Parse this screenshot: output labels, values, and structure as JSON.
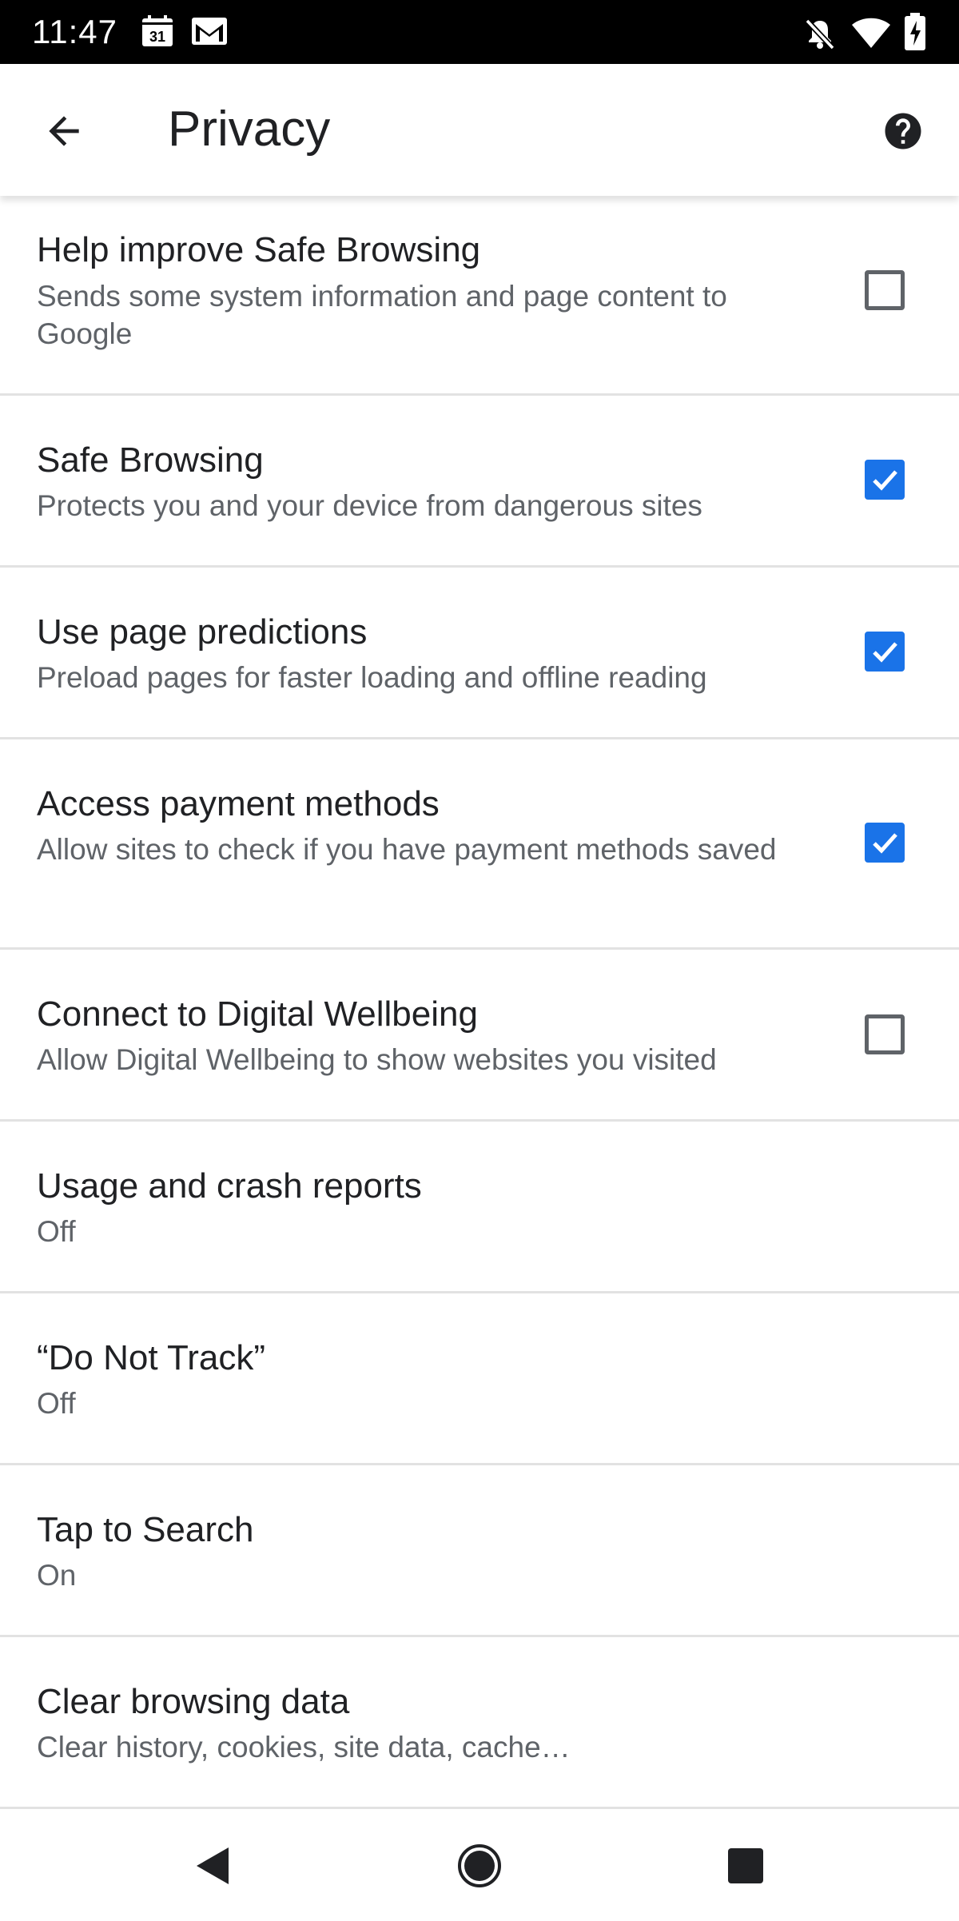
{
  "status_bar": {
    "time": "11:47",
    "calendar_day": "31",
    "left_icons": [
      "calendar-icon",
      "gmail-icon"
    ],
    "right_icons": [
      "notifications-off-icon",
      "wifi-icon",
      "battery-charging-icon"
    ]
  },
  "app_bar": {
    "title": "Privacy",
    "back_icon": "arrow-back-icon",
    "help_icon": "help-icon"
  },
  "colors": {
    "accent": "#1a73e8",
    "title_text": "#202124",
    "subtitle_text": "#5f6368",
    "divider": "#e2e2e2"
  },
  "settings": [
    {
      "title": "Help improve Safe Browsing",
      "subtitle": "Sends some system information and page content to Google",
      "control": "checkbox",
      "checked": false
    },
    {
      "title": "Safe Browsing",
      "subtitle": "Protects you and your device from dangerous sites",
      "control": "checkbox",
      "checked": true
    },
    {
      "title": "Use page predictions",
      "subtitle": "Preload pages for faster loading and offline reading",
      "control": "checkbox",
      "checked": true
    },
    {
      "title": "Access payment methods",
      "subtitle": "Allow sites to check if you have payment methods saved",
      "control": "checkbox",
      "checked": true
    },
    {
      "title": "Connect to Digital Wellbeing",
      "subtitle": "Allow Digital Wellbeing to show websites you visited",
      "control": "checkbox",
      "checked": false
    },
    {
      "title": "Usage and crash reports",
      "subtitle": "Off",
      "control": "none"
    },
    {
      "title": "“Do Not Track”",
      "subtitle": "Off",
      "control": "none"
    },
    {
      "title": "Tap to Search",
      "subtitle": "On",
      "control": "none"
    },
    {
      "title": "Clear browsing data",
      "subtitle": "Clear history, cookies, site data, cache…",
      "control": "none"
    }
  ],
  "nav_bar": {
    "icons": [
      "nav-back-icon",
      "nav-home-icon",
      "nav-recents-icon"
    ]
  }
}
